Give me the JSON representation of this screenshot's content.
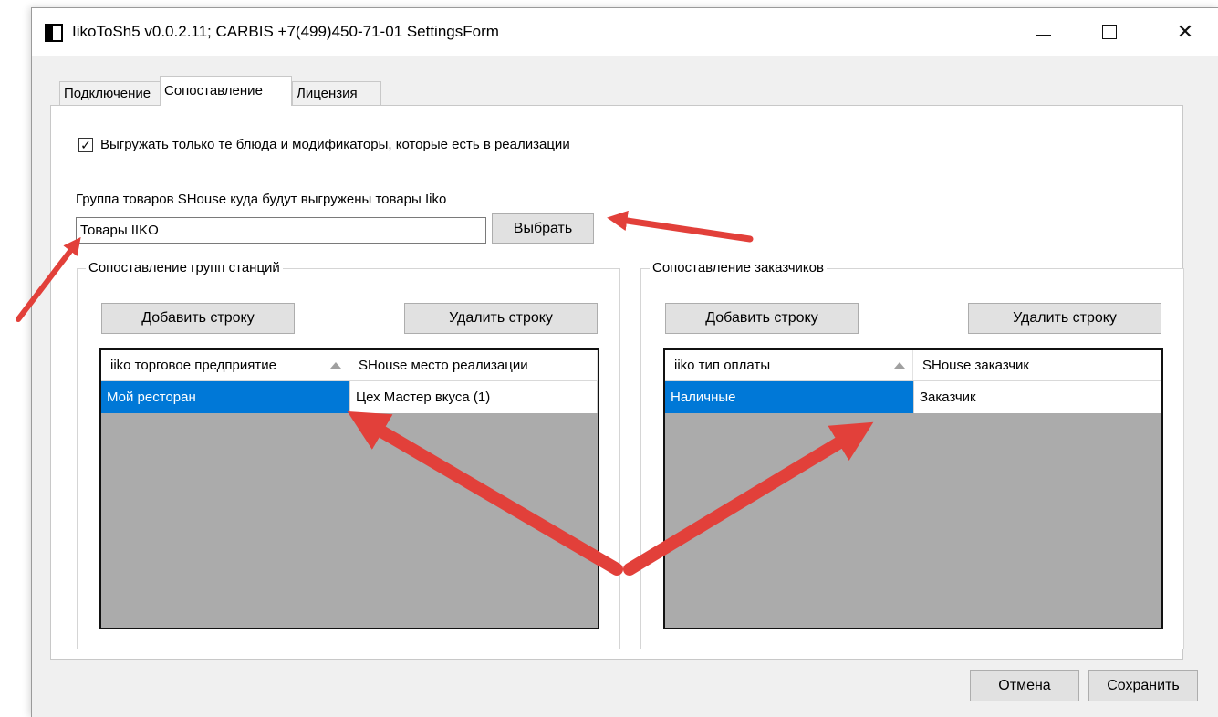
{
  "window": {
    "title": "IikoToSh5 v0.0.2.11;  CARBIS +7(499)450-71-01 SettingsForm",
    "minimize_glyph": "—",
    "close_glyph": "✕"
  },
  "tabs": [
    {
      "label": "Подключение",
      "active": false
    },
    {
      "label": "Сопоставление",
      "active": true
    },
    {
      "label": "Лицензия",
      "active": false
    }
  ],
  "export_checkbox": {
    "label": "Выгружать только те блюда и модификаторы, которые есть в реализации",
    "checked": true,
    "check_glyph": "✓"
  },
  "product_group": {
    "label": "Группа товаров SHouse куда будут выгружены товары Iiko",
    "value": "Товары IIKO",
    "choose_label": "Выбрать"
  },
  "stations_group": {
    "title": "Сопоставление групп станций",
    "add_label": "Добавить строку",
    "delete_label": "Удалить строку",
    "columns": [
      "iiko торговое предприятие",
      "SHouse место реализации"
    ],
    "rows": [
      [
        "Мой ресторан",
        "Цех Мастер вкуса (1)"
      ]
    ]
  },
  "customers_group": {
    "title": "Сопоставление заказчиков",
    "add_label": "Добавить строку",
    "delete_label": "Удалить строку",
    "columns": [
      "iiko тип оплаты",
      "SHouse заказчик"
    ],
    "rows": [
      [
        "Наличные",
        "Заказчик"
      ]
    ]
  },
  "footer": {
    "cancel_label": "Отмена",
    "save_label": "Сохранить"
  },
  "colors": {
    "selection": "#0078d7",
    "arrow": "#e2403a",
    "grid_bg": "#ababab"
  }
}
